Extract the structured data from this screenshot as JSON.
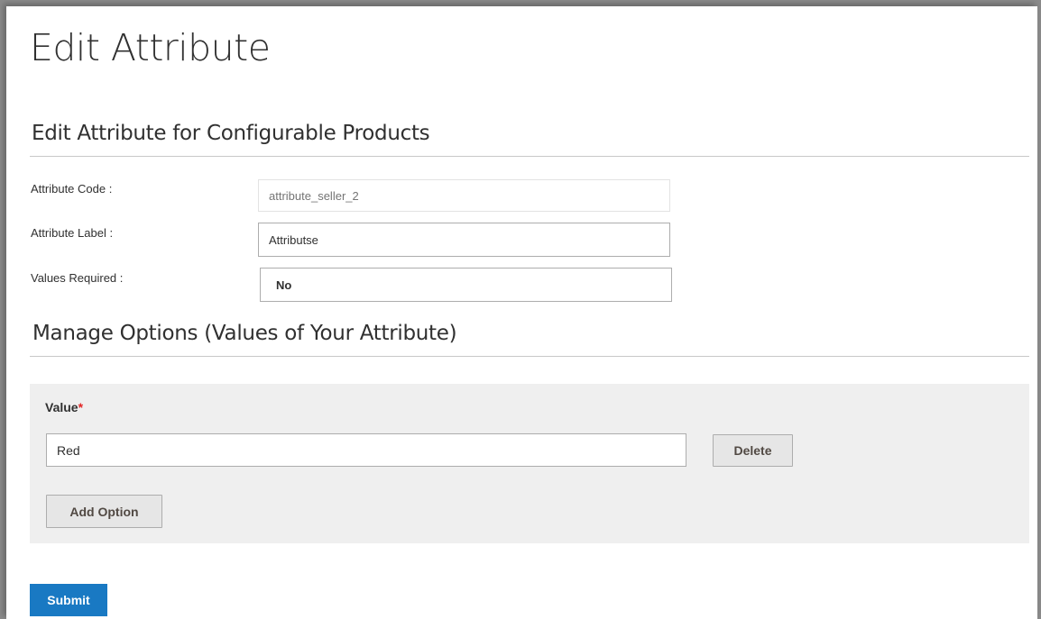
{
  "page": {
    "title": "Edit Attribute"
  },
  "attribute_section": {
    "title": "Edit Attribute for Configurable Products",
    "fields": [
      {
        "label": "Attribute Code :",
        "value": "",
        "placeholder": "attribute_seller_2"
      },
      {
        "label": "Attribute Label :",
        "value": "Attributse"
      },
      {
        "label": "Values Required :",
        "value": "No"
      }
    ]
  },
  "options_section": {
    "title": "Manage Options (Values of Your Attribute)",
    "value_label": "Value",
    "required_marker": "*",
    "options": [
      {
        "value": "Red",
        "delete_label": "Delete"
      }
    ],
    "add_option_label": "Add Option"
  },
  "actions": {
    "submit_label": "Submit"
  },
  "colors": {
    "primary_button": "#1979c3",
    "required_marker": "#e22626",
    "panel_background": "#efefef"
  }
}
